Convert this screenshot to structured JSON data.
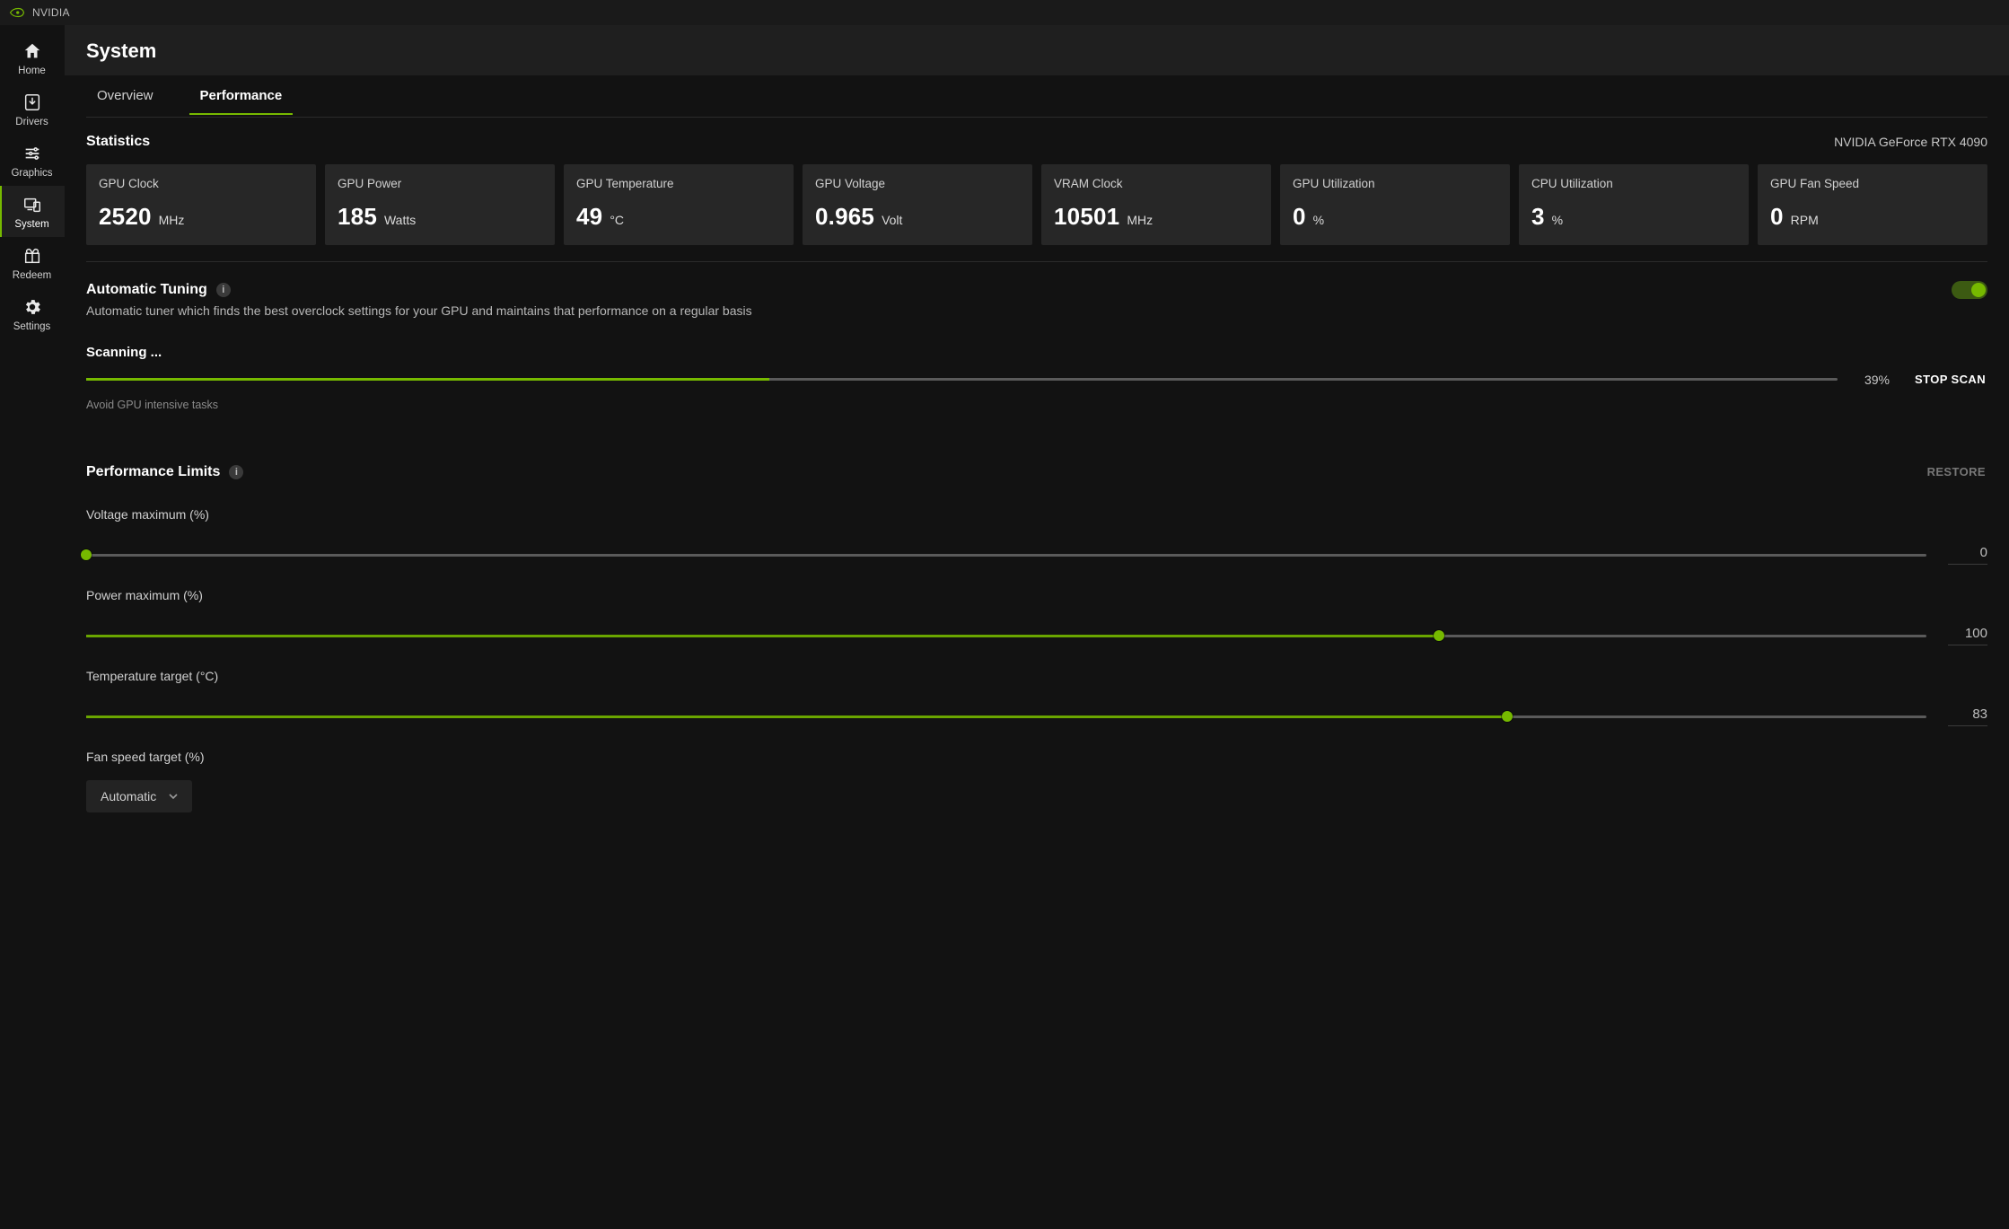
{
  "app_name": "NVIDIA",
  "accent": "#76b900",
  "header": {
    "title": "System"
  },
  "sidebar": {
    "items": [
      {
        "id": "home",
        "label": "Home"
      },
      {
        "id": "drivers",
        "label": "Drivers"
      },
      {
        "id": "graphics",
        "label": "Graphics"
      },
      {
        "id": "system",
        "label": "System"
      },
      {
        "id": "redeem",
        "label": "Redeem"
      },
      {
        "id": "settings",
        "label": "Settings"
      }
    ],
    "active": "system"
  },
  "tabs": {
    "items": [
      "Overview",
      "Performance"
    ],
    "active": "Performance"
  },
  "gpu_model": "NVIDIA GeForce RTX 4090",
  "sections": {
    "statistics_title": "Statistics",
    "auto_tuning": {
      "title": "Automatic Tuning",
      "desc": "Automatic tuner which finds the best overclock settings for your GPU and maintains that performance on a regular basis",
      "enabled": true,
      "scan_status": "Scanning ...",
      "scan_note": "Avoid GPU intensive tasks",
      "scan_pct": "39%",
      "stop_label": "STOP SCAN"
    },
    "perf_limits": {
      "title": "Performance Limits",
      "restore_label": "RESTORE",
      "voltage": {
        "label": "Voltage maximum (%)",
        "value": "0",
        "pct": 0
      },
      "power": {
        "label": "Power maximum (%)",
        "value": "100",
        "pct": 73.5
      },
      "temp": {
        "label": "Temperature target (°C)",
        "value": "83",
        "pct": 77.2
      },
      "fan": {
        "label": "Fan speed target (%)",
        "selected": "Automatic"
      }
    }
  },
  "stats": [
    {
      "label": "GPU Clock",
      "value": "2520",
      "unit": "MHz"
    },
    {
      "label": "GPU Power",
      "value": "185",
      "unit": "Watts"
    },
    {
      "label": "GPU Temperature",
      "value": "49",
      "unit": "°C"
    },
    {
      "label": "GPU Voltage",
      "value": "0.965",
      "unit": "Volt"
    },
    {
      "label": "VRAM Clock",
      "value": "10501",
      "unit": "MHz"
    },
    {
      "label": "GPU Utilization",
      "value": "0",
      "unit": "%"
    },
    {
      "label": "CPU Utilization",
      "value": "3",
      "unit": "%"
    },
    {
      "label": "GPU Fan Speed",
      "value": "0",
      "unit": "RPM"
    }
  ]
}
